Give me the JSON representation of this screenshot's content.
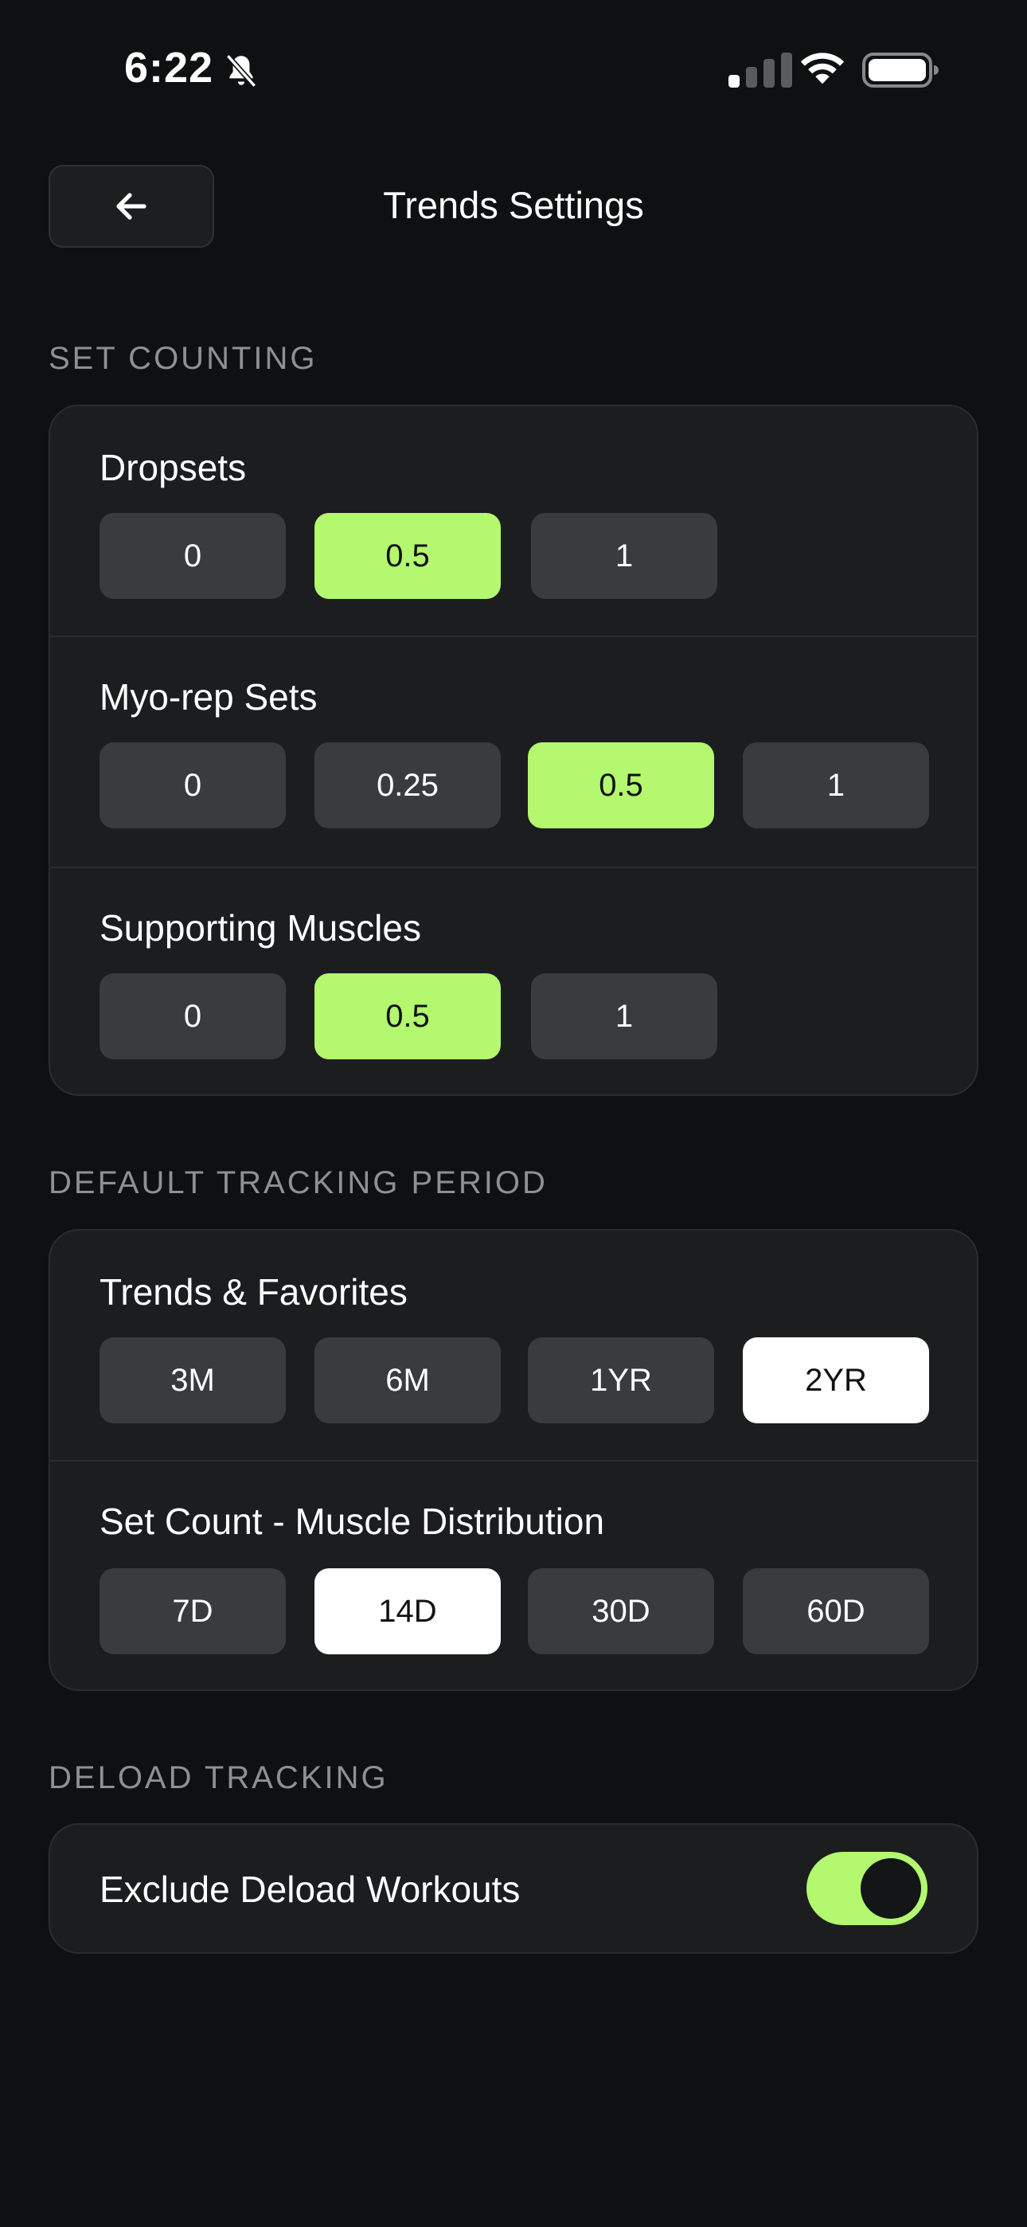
{
  "status_bar": {
    "time": "6:22",
    "icons": [
      "bell-slash-icon",
      "cellular-signal-icon",
      "wifi-icon",
      "battery-icon"
    ]
  },
  "header": {
    "back_icon": "arrow-left-icon",
    "title": "Trends Settings"
  },
  "set_counting": {
    "label": "SET COUNTING",
    "dropsets": {
      "title": "Dropsets",
      "options": [
        "0",
        "0.5",
        "1"
      ],
      "selected": "0.5"
    },
    "myo_rep": {
      "title": "Myo-rep Sets",
      "options": [
        "0",
        "0.25",
        "0.5",
        "1"
      ],
      "selected": "0.5"
    },
    "supporting": {
      "title": "Supporting Muscles",
      "options": [
        "0",
        "0.5",
        "1"
      ],
      "selected": "0.5"
    }
  },
  "tracking_period": {
    "label": "DEFAULT TRACKING PERIOD",
    "trends": {
      "title": "Trends & Favorites",
      "options": [
        "3M",
        "6M",
        "1YR",
        "2YR"
      ],
      "selected": "2YR"
    },
    "distribution": {
      "title": "Set Count - Muscle Distribution",
      "options": [
        "7D",
        "14D",
        "30D",
        "60D"
      ],
      "selected": "14D"
    }
  },
  "deload": {
    "label": "DELOAD TRACKING",
    "exclude": {
      "title": "Exclude Deload Workouts",
      "enabled": true
    }
  },
  "colors": {
    "background": "#0f1011",
    "card": "#1c1d1f",
    "option": "#3a3b3e",
    "accent_green": "#b3f86e",
    "selected_white": "#ffffff"
  }
}
